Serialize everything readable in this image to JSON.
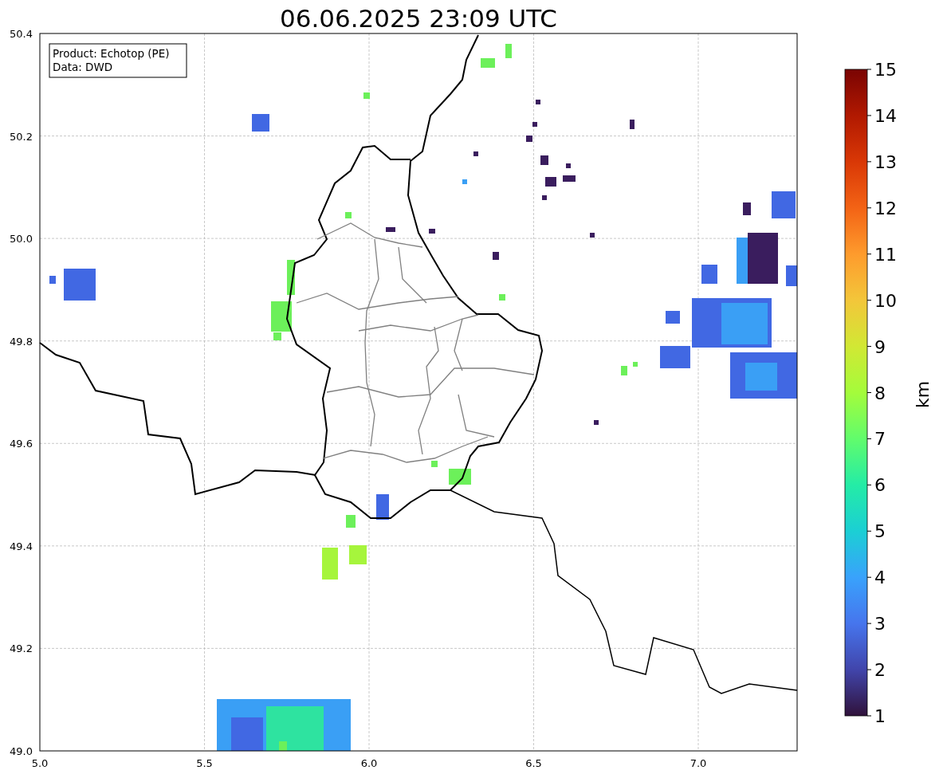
{
  "title": "06.06.2025 23:09 UTC",
  "info_box": [
    "Product: Echotop (PE)",
    "Data: DWD"
  ],
  "map": {
    "xticks": [
      "5.0",
      "5.5",
      "6.0",
      "6.5",
      "7.0"
    ],
    "yticks": [
      "50.4",
      "50.2",
      "50.0",
      "49.8",
      "49.6",
      "49.4",
      "49.2",
      "49.0"
    ]
  },
  "colorbar": {
    "label": "km",
    "ticks": [
      "15",
      "14",
      "13",
      "12",
      "11",
      "10",
      "9",
      "8",
      "7",
      "6",
      "5",
      "4",
      "3",
      "2",
      "1"
    ]
  }
}
